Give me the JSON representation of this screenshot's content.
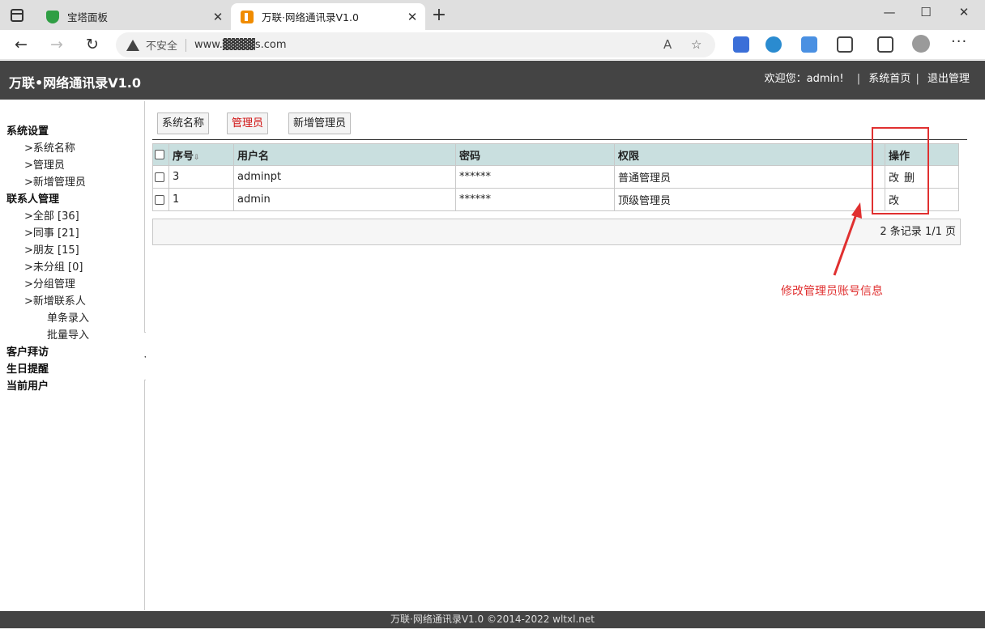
{
  "browser": {
    "tabs": [
      {
        "title": "宝塔面板",
        "close": "✕"
      },
      {
        "title": "万联·网络通讯录V1.0",
        "close": "✕"
      }
    ],
    "new_tab": "+",
    "window_controls": {
      "minimize": "—",
      "maximize": "☐",
      "close": "✕"
    },
    "nav": {
      "back": "←",
      "forward": "→",
      "reload": "↻"
    },
    "security_label": "不安全",
    "url": "www.▓▓▓▓s.com",
    "more": "···"
  },
  "app": {
    "title": "万联•网络通讯录V1.0",
    "welcome": "欢迎您：admin!",
    "links": [
      "系统首页",
      "退出管理"
    ]
  },
  "sidebar": {
    "items": [
      {
        "label": "系统设置",
        "level": 0
      },
      {
        "label": ">系统名称",
        "level": 1
      },
      {
        "label": ">管理员",
        "level": 1
      },
      {
        "label": ">新增管理员",
        "level": 1
      },
      {
        "label": "联系人管理",
        "level": 0
      },
      {
        "label": ">全部 [36]",
        "level": 1
      },
      {
        "label": ">同事 [21]",
        "level": 1
      },
      {
        "label": ">朋友 [15]",
        "level": 1
      },
      {
        "label": ">未分组 [0]",
        "level": 1
      },
      {
        "label": ">分组管理",
        "level": 1
      },
      {
        "label": ">新增联系人",
        "level": 1
      },
      {
        "label": "单条录入",
        "level": 2
      },
      {
        "label": "批量导入",
        "level": 2
      },
      {
        "label": "客户拜访",
        "level": 0
      },
      {
        "label": "生日提醒",
        "level": 0
      },
      {
        "label": "当前用户",
        "level": 0
      }
    ],
    "collapse_glyph": "◂"
  },
  "main": {
    "tabs": [
      "系统名称",
      "管理员",
      "新增管理员"
    ],
    "active_tab": "管理员",
    "table": {
      "headers": [
        "序号",
        "用户名",
        "密码",
        "权限",
        "操作"
      ],
      "sort_glyph": "⇩",
      "rows": [
        {
          "id": "3",
          "username": "adminpt",
          "password": "******",
          "role": "普通管理员",
          "actions": [
            "改",
            "删"
          ]
        },
        {
          "id": "1",
          "username": "admin",
          "password": "******",
          "role": "顶级管理员",
          "actions": [
            "改"
          ]
        }
      ]
    },
    "pager": "2 条记录 1/1 页"
  },
  "annotation": {
    "text": "修改管理员账号信息",
    "color": "#e03030"
  },
  "footer": "万联·网络通讯录V1.0 ©2014-2022 wltxl.net",
  "colors": {
    "header_bg": "#444444",
    "table_header_bg": "#c9dfdf",
    "active_tab_text": "#d01010"
  }
}
